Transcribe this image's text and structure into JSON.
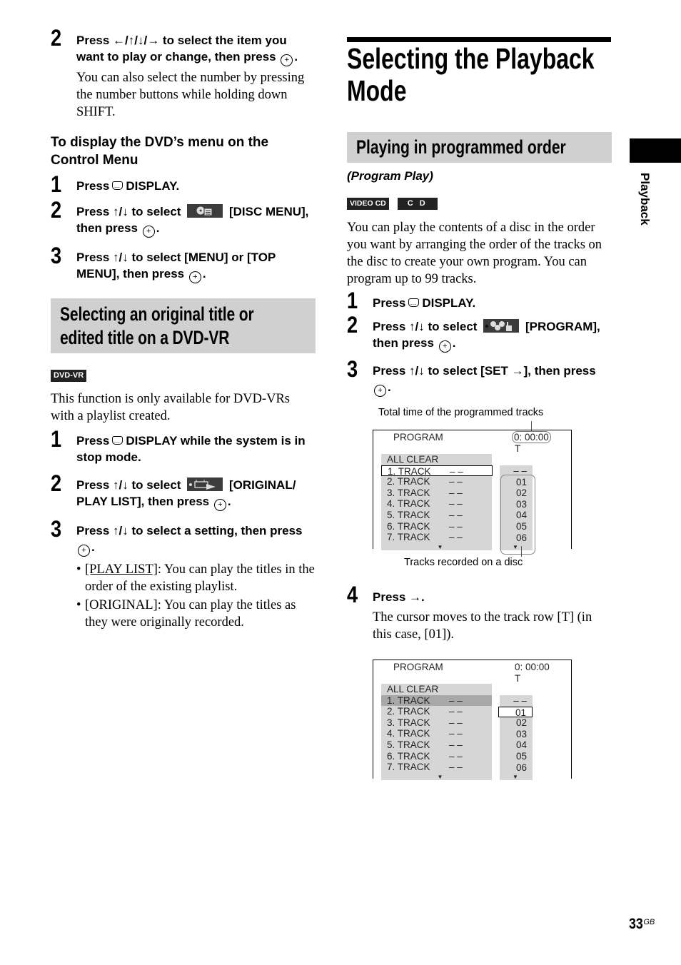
{
  "left_column": {
    "top_step": {
      "number": "2",
      "instruction_a": "Press ←/↑/↓/→ to select the item you want to play or change, then press",
      "instruction_end": ".",
      "note": "You can also select the number by pressing the number buttons while holding down SHIFT."
    },
    "dvd_menu": {
      "heading": "To display the DVD’s menu on the Control Menu",
      "steps": [
        {
          "number": "1",
          "pre": "Press",
          "post": "DISPLAY."
        },
        {
          "number": "2",
          "pre": "Press ↑/↓ to select",
          "post": "[DISC MENU], then press",
          "end": ".",
          "icon": "disc-menu-icon"
        },
        {
          "number": "3",
          "pre": "Press ↑/↓ to select [MENU] or [TOP MENU], then press",
          "end": "."
        }
      ]
    },
    "dvd_vr_section": {
      "heading": "Selecting an original title or edited title on a DVD-VR",
      "badge": "DVD-VR",
      "intro": "This function is only available for DVD-VRs with a playlist created.",
      "steps": [
        {
          "number": "1",
          "pre": "Press",
          "post": "DISPLAY while the system is in stop mode."
        },
        {
          "number": "2",
          "pre": "Press ↑/↓ to select",
          "post": "[ORIGINAL/ PLAY LIST], then press",
          "end": ".",
          "icon": "original-playlist-icon"
        },
        {
          "number": "3",
          "pre": "Press ↑/↓ to select a setting, then press",
          "end": "."
        }
      ],
      "options": [
        {
          "label": "[PLAY LIST]",
          "text": ": You can play the titles in the order of the existing playlist.",
          "default": true
        },
        {
          "label": "[ORIGINAL]",
          "text": ": You can play the titles as they were originally recorded.",
          "default": false
        }
      ]
    }
  },
  "right_column": {
    "title": "Selecting the Playback Mode",
    "section_heading": "Playing in programmed order",
    "subtitle": "(Program Play)",
    "badges": [
      "VIDEO CD",
      "C D"
    ],
    "intro": "You can play the contents of a disc in the order you want by arranging the order of the tracks on the disc to create your own program. You can program up to 99 tracks.",
    "steps": [
      {
        "number": "1",
        "pre": "Press",
        "post": "DISPLAY."
      },
      {
        "number": "2",
        "pre": "Press ↑/↓ to select",
        "post": "[PROGRAM], then press",
        "end": ".",
        "icon": "program-icon"
      },
      {
        "number": "3",
        "pre": "Press ↑/↓ to select [SET →], then press",
        "end": "."
      },
      {
        "number": "4",
        "pre": "Press →.",
        "note": "The cursor moves to the track row [T] (in this case, [01])."
      }
    ],
    "callouts": {
      "total_time": "Total time of the programmed tracks",
      "tracks_recorded": "Tracks recorded on a disc"
    },
    "osd_screens": [
      {
        "title": "PROGRAM",
        "time": "0: 00:00",
        "track_label": "T",
        "menu_items": [
          "ALL CLEAR",
          "1. TRACK",
          "2. TRACK",
          "3. TRACK",
          "4. TRACK",
          "5. TRACK",
          "6. TRACK",
          "7. TRACK"
        ],
        "item_value": "– –",
        "selected_item": "1. TRACK",
        "tracks": [
          "– –",
          "01",
          "02",
          "03",
          "04",
          "05",
          "06"
        ],
        "selected_track": null
      },
      {
        "title": "PROGRAM",
        "time": "0: 00:00",
        "track_label": "T",
        "menu_items": [
          "ALL CLEAR",
          "1. TRACK",
          "2. TRACK",
          "3. TRACK",
          "4. TRACK",
          "5. TRACK",
          "6. TRACK",
          "7. TRACK"
        ],
        "item_value": "– –",
        "selected_item": "1. TRACK",
        "tracks": [
          "– –",
          "01",
          "02",
          "03",
          "04",
          "05",
          "06"
        ],
        "selected_track": "01"
      }
    ]
  },
  "side_tab": {
    "label": "Playback"
  },
  "footer": {
    "page_number": "33",
    "suffix": "GB"
  }
}
